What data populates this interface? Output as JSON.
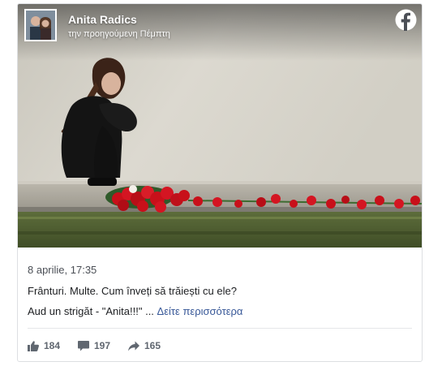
{
  "post": {
    "author_name": "Anita Radics",
    "time_ago": "την προηγούμενη Πέμπτη",
    "brand_icon": "facebook-icon",
    "date": "8 aprilie, 17:35",
    "text_line_1": "Frânturi. Multe. Cum înveți să trăiești cu ele?",
    "text_line_2": "Aud un strigăt - \"Anita!!!\" ...",
    "see_more_label": "Δείτε περισσότερα"
  },
  "stats": {
    "likes": "184",
    "comments": "197",
    "shares": "165",
    "like_icon": "thumbs-up-icon",
    "comment_icon": "comment-icon",
    "share_icon": "share-arrow-icon"
  },
  "colors": {
    "link": "#385898",
    "muted": "#606770",
    "text": "#1c1e21",
    "border": "#dddfe2",
    "flower_red": "#c8101a"
  }
}
